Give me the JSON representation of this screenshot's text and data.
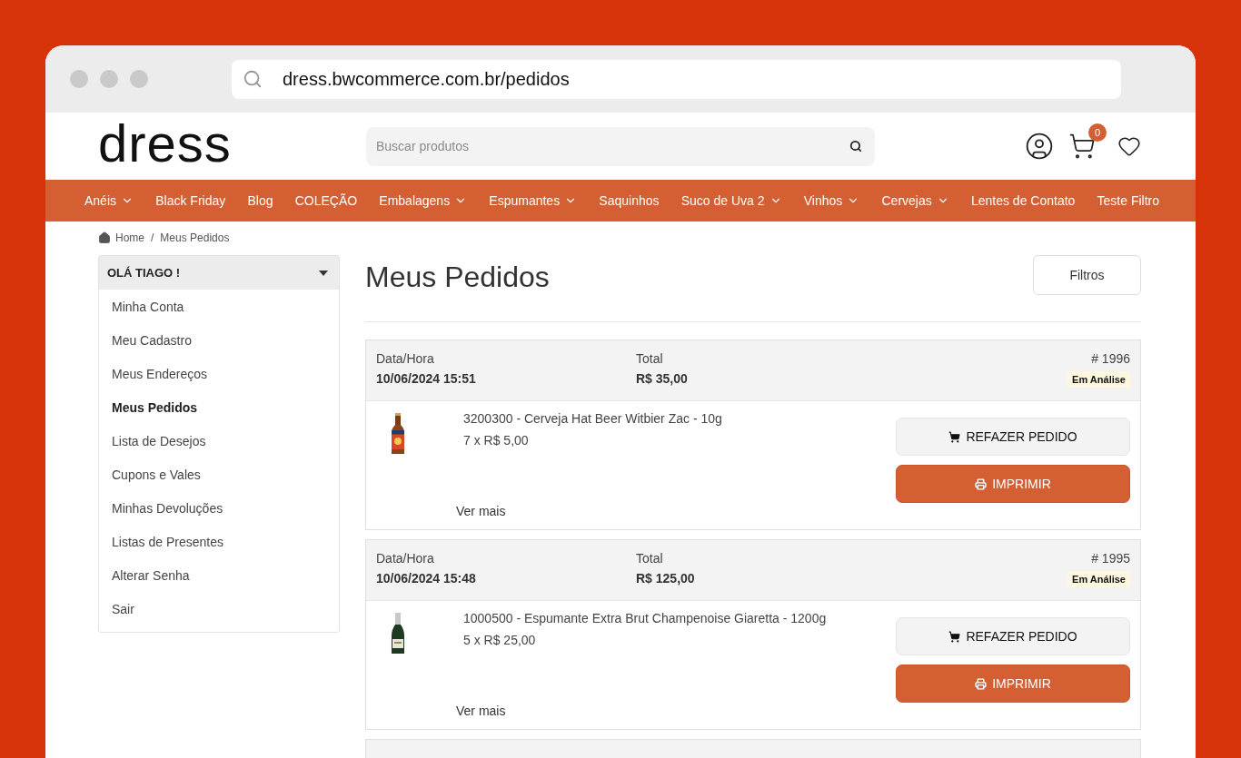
{
  "browser": {
    "url": "dress.bwcommerce.com.br/pedidos"
  },
  "header": {
    "logo": "dress",
    "search": {
      "placeholder": "Buscar produtos"
    },
    "cart_count": "0"
  },
  "nav": {
    "items": [
      {
        "label": "Anéis",
        "has_dropdown": true
      },
      {
        "label": "Black Friday",
        "has_dropdown": false
      },
      {
        "label": "Blog",
        "has_dropdown": false
      },
      {
        "label": "COLEÇÃO",
        "has_dropdown": false
      },
      {
        "label": "Embalagens",
        "has_dropdown": true
      },
      {
        "label": "Espumantes",
        "has_dropdown": true
      },
      {
        "label": "Saquinhos",
        "has_dropdown": false
      },
      {
        "label": "Suco de Uva 2",
        "has_dropdown": true
      },
      {
        "label": "Vinhos",
        "has_dropdown": true
      },
      {
        "label": "Cervejas",
        "has_dropdown": true
      },
      {
        "label": "Lentes de Contato",
        "has_dropdown": false
      },
      {
        "label": "Teste Filtro",
        "has_dropdown": false
      }
    ]
  },
  "breadcrumb": {
    "items": [
      "Home",
      "Meus Pedidos"
    ],
    "separator": "/"
  },
  "sidebar": {
    "title": "OLÁ TIAGO !",
    "expanded": true,
    "items": [
      {
        "label": "Minha Conta",
        "selected": false
      },
      {
        "label": "Meu Cadastro",
        "selected": false
      },
      {
        "label": "Meus Endereços",
        "selected": false
      },
      {
        "label": "Meus Pedidos",
        "selected": true
      },
      {
        "label": "Lista de Desejos",
        "selected": false
      },
      {
        "label": "Cupons e Vales",
        "selected": false
      },
      {
        "label": "Minhas Devoluções",
        "selected": false
      },
      {
        "label": "Listas de Presentes",
        "selected": false
      },
      {
        "label": "Alterar Senha",
        "selected": false
      },
      {
        "label": "Sair",
        "selected": false
      }
    ]
  },
  "main": {
    "title": "Meus Pedidos",
    "filter_button": "Filtros"
  },
  "orders": [
    {
      "date_label": "Data/Hora",
      "date": "10/06/2024 15:51",
      "total_label": "Total",
      "total": "R$ 35,00",
      "number": "# 1996",
      "status": "Em Análise",
      "items": [
        {
          "product": "3200300 - Cerveja Hat Beer Witbier Zac - 10g",
          "quantity": "7 x R$ 5,00"
        }
      ],
      "more_link": "Ver mais",
      "reorder_button": "REFAZER PEDIDO",
      "print_button": "IMPRIMIR"
    },
    {
      "date_label": "Data/Hora",
      "date": "10/06/2024 15:48",
      "total_label": "Total",
      "total": "R$ 125,00",
      "number": "# 1995",
      "status": "Em Análise",
      "items": [
        {
          "product": "1000500 - Espumante Extra Brut Champenoise Giaretta - 1200g",
          "quantity": "5 x R$ 25,00"
        }
      ],
      "more_link": "Ver mais",
      "reorder_button": "REFAZER PEDIDO",
      "print_button": "IMPRIMIR"
    }
  ]
}
